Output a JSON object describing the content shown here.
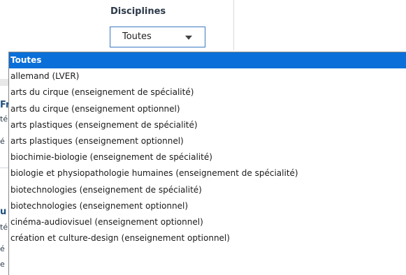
{
  "filter": {
    "title": "Disciplines",
    "selected_value": "Toutes",
    "caret_icon": "chevron-down-icon"
  },
  "background_fragments": [
    {
      "text": "Fr",
      "row": 1
    },
    {
      "text": "té",
      "row": 2
    },
    {
      "text": "é",
      "row": 3
    },
    {
      "text": "u",
      "row": 4
    },
    {
      "text": "té",
      "row": 5
    },
    {
      "text": "é",
      "row": 6
    },
    {
      "text": "e",
      "row": 7
    }
  ],
  "dropdown": {
    "selected_index": 0,
    "options": [
      "Toutes",
      "allemand (LVER)",
      "arts du cirque (enseignement de spécialité)",
      "arts du cirque (enseignement optionnel)",
      "arts plastiques (enseignement de spécialité)",
      "arts plastiques (enseignement optionnel)",
      "biochimie-biologie (enseignement de spécialité)",
      "biologie et physiopathologie humaines (enseignement de spécialité)",
      "biotechnologies (enseignement de spécialité)",
      "biotechnologies (enseignement optionnel)",
      "cinéma-audiovisuel (enseignement optionnel)",
      "création et culture-design (enseignement optionnel)"
    ]
  },
  "colors": {
    "selected_bg": "#0a6fd8",
    "selected_text": "#ffffff",
    "select_border": "#3a78c2",
    "title_text": "#2d3a4a"
  }
}
